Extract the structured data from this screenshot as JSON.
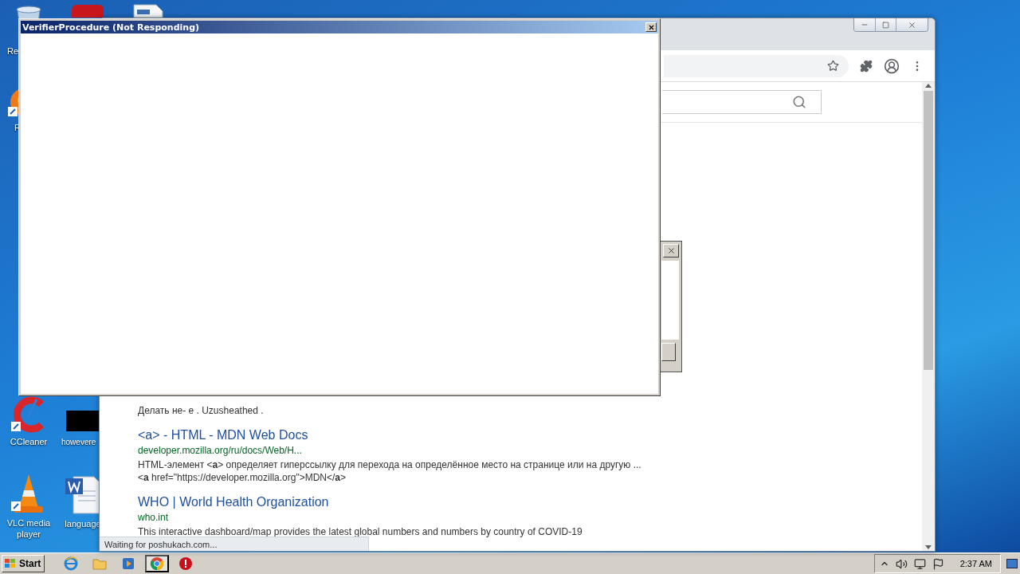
{
  "desktop": {
    "icons": [
      {
        "kind": "recycle",
        "label": "Re"
      },
      {
        "kind": "red-app"
      },
      {
        "kind": "document"
      },
      {
        "kind": "firefox",
        "label": "F"
      },
      {
        "kind": "ccleaner",
        "label": "CCleaner"
      },
      {
        "kind": "black",
        "label": "howevere"
      },
      {
        "kind": "vlc",
        "label": "VLC media player"
      },
      {
        "kind": "word",
        "label": "language"
      }
    ]
  },
  "browser": {
    "status_text": "Waiting for poshukach.com...",
    "results": [
      {
        "snippet": "Делать не- е . Uzusheathed ."
      },
      {
        "title": "<a> - HTML - MDN Web Docs",
        "url": "developer.mozilla.org/ru/docs/Web/H...",
        "snippet": "HTML-элемент <**a**> определяет гиперссылку для перехода на определённое место на странице или на другую ... <**a** href=\"https://developer.mozilla.org\">MDN</**a**>"
      },
      {
        "title": "WHO | World Health Organization",
        "url": "who.int",
        "snippet": "This interactive dashboard/map provides the latest global numbers and numbers by country of COVID-19"
      }
    ]
  },
  "verifier_window": {
    "title": "VerifierProcedure (Not Responding)"
  },
  "taskbar": {
    "start": "Start",
    "apps": [
      {
        "kind": "ie",
        "selected": false
      },
      {
        "kind": "explorer",
        "selected": false
      },
      {
        "kind": "media",
        "selected": false
      },
      {
        "kind": "chrome",
        "selected": true
      },
      {
        "kind": "stop",
        "selected": false
      }
    ],
    "clock": "2:37 AM"
  }
}
